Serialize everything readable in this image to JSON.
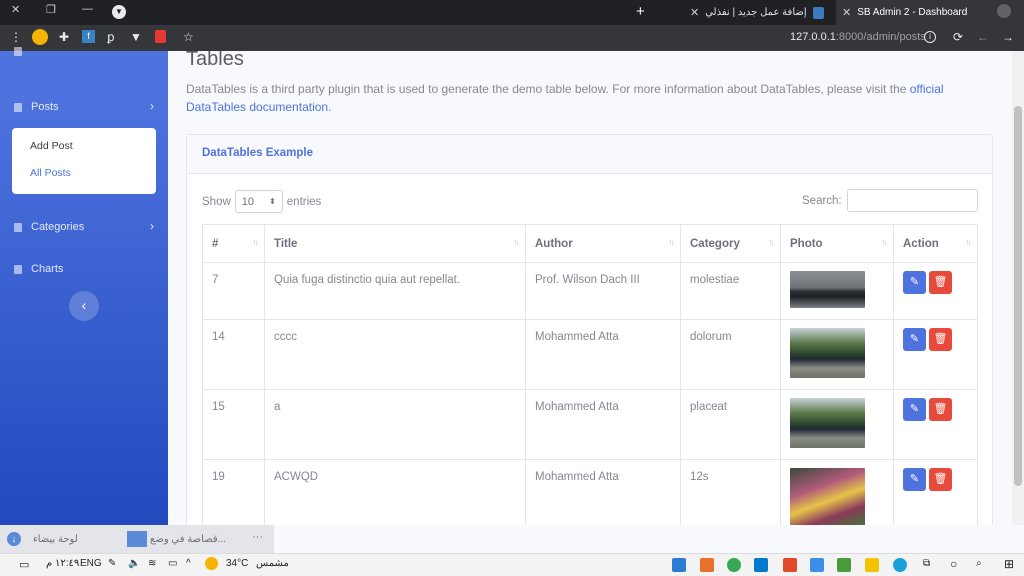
{
  "browser": {
    "active_tab": "SB Admin 2 - Dashboard",
    "other_tab": "إضافة عمل جديد | نفذلي",
    "url_host": "127.0.0.1",
    "url_path": ":8000/admin/posts"
  },
  "sidebar": {
    "posts_label": "Posts",
    "posts_submenu": [
      "Add Post",
      "All Posts"
    ],
    "categories_label": "Categories",
    "charts_label": "Charts"
  },
  "page": {
    "title": "Tables",
    "description": "DataTables is a third party plugin that is used to generate the demo table below. For more information about DataTables, please visit the ",
    "link_text": "official DataTables documentation",
    "description_end": "."
  },
  "card": {
    "title": "DataTables Example",
    "show_label": "Show",
    "entries_value": "10",
    "entries_label": "entries",
    "search_label": "Search:"
  },
  "table": {
    "columns": [
      "#",
      "Title",
      "Author",
      "Category",
      "Photo",
      "Action"
    ],
    "rows": [
      {
        "id": "7",
        "title": "Quia fuga distinctio quia aut repellat.",
        "author": "Prof. Wilson Dach III",
        "category": "molestiae"
      },
      {
        "id": "14",
        "title": "cccc",
        "author": "Mohammed Atta",
        "category": "dolorum"
      },
      {
        "id": "15",
        "title": "a",
        "author": "Mohammed Atta",
        "category": "placeat"
      },
      {
        "id": "19",
        "title": "ACWQD",
        "author": "Mohammed Atta",
        "category": "12s"
      }
    ]
  },
  "downloads": {
    "item1": "لوحة بيضاء",
    "item2": "قصاصة في وضع..."
  },
  "taskbar": {
    "time": "١٢:٤٩ م",
    "lang": "ENG",
    "weather": "34°C",
    "weather_desc": "مشمس"
  },
  "colors": {
    "primary": "#4e73df",
    "danger": "#e74a3b",
    "sidebar_dark": "#224abe"
  }
}
